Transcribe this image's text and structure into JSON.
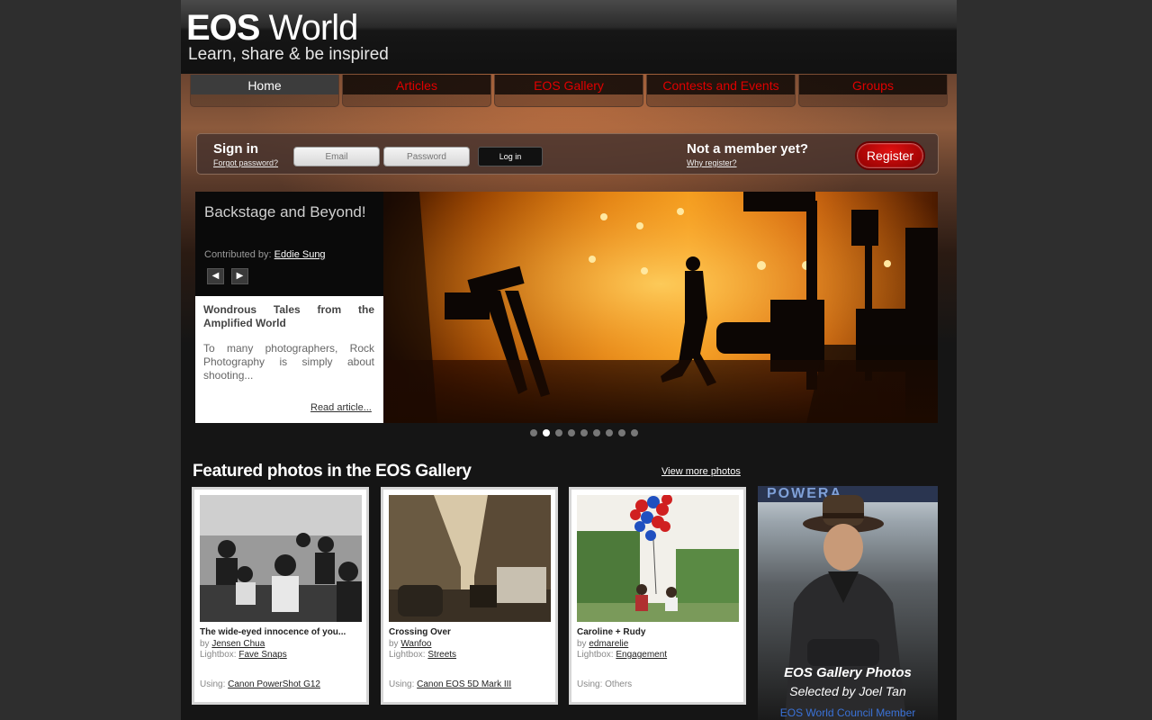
{
  "header": {
    "logo_main": "EOS World",
    "logo_bold": "EOS",
    "logo_light": "World",
    "tagline": "Learn, share & be inspired"
  },
  "nav": [
    {
      "label": "Home",
      "active": true
    },
    {
      "label": "Articles",
      "active": false
    },
    {
      "label": "EOS Gallery",
      "active": false
    },
    {
      "label": "Contests and Events",
      "active": false
    },
    {
      "label": "Groups",
      "active": false
    }
  ],
  "signin": {
    "title": "Sign in",
    "forgot": "Forgot password?",
    "email_placeholder": "Email",
    "password_placeholder": "Password",
    "login_label": "Log in",
    "not_member": "Not a member yet?",
    "why_register": "Why register?",
    "register_label": "Register"
  },
  "feature": {
    "title": "Backstage and Beyond!",
    "contributed_by_label": "Contributed by:",
    "contributor": "Eddie Sung",
    "prev_glyph": "◀",
    "next_glyph": "▶",
    "article_title": "Wondrous Tales from the Amplified World",
    "article_excerpt": "To many photographers, Rock Photography is simply about shooting...",
    "read_more": "Read article..."
  },
  "carousel": {
    "count": 9,
    "active_index": 1
  },
  "featured": {
    "heading": "Featured photos in the EOS Gallery",
    "view_more": "View more photos",
    "cards": [
      {
        "title": "The wide-eyed innocence of you...",
        "by_label": "by",
        "author": "Jensen Chua",
        "lightbox_label": "Lightbox:",
        "lightbox": "Fave Snaps",
        "using_label": "Using:",
        "camera": "Canon PowerShot G12",
        "camera_linked": true
      },
      {
        "title": "Crossing Over",
        "by_label": "by",
        "author": "Wanfoo",
        "lightbox_label": "Lightbox:",
        "lightbox": "Streets",
        "using_label": "Using:",
        "camera": "Canon EOS 5D Mark III",
        "camera_linked": true
      },
      {
        "title": "Caroline + Rudy",
        "by_label": "by",
        "author": "edmarelie",
        "lightbox_label": "Lightbox:",
        "lightbox": "Engagement",
        "using_label": "Using:",
        "camera": "Others",
        "camera_linked": false
      }
    ]
  },
  "promo": {
    "sign_text": "POWERA",
    "line1": "EOS Gallery Photos",
    "line2": "Selected by Joel Tan",
    "line3": "EOS World Council Member"
  },
  "colors": {
    "nav_text": "#e00000",
    "register_button": "#c00000",
    "promo_link": "#3a72d8"
  }
}
